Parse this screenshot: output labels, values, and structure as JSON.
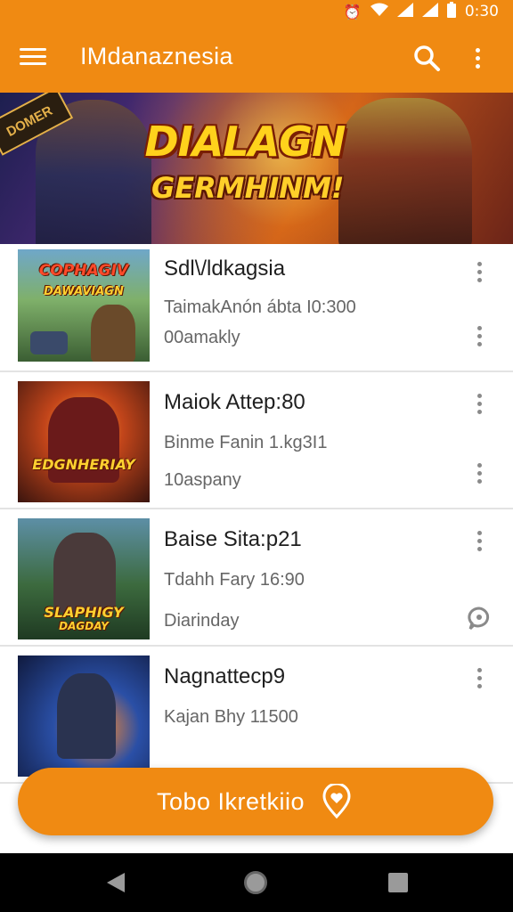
{
  "status_bar": {
    "time": "0:30",
    "icons": [
      "alarm-icon",
      "wifi-icon",
      "signal-icon",
      "signal-icon-2",
      "battery-icon"
    ]
  },
  "app_bar": {
    "title": "IMdanaznesia",
    "icons": [
      "menu-icon",
      "search-icon",
      "more-vert-icon"
    ]
  },
  "banner": {
    "title": "DIALAGN",
    "subtitle": "GERMHINM!",
    "corner_badge": "DOMER"
  },
  "items": [
    {
      "title": "Sdl\\/ldkagsia",
      "subtitle": "TaimakAnón ábta I0:300",
      "meta": "00amakly",
      "thumb_label": "COPHAGIV",
      "thumb_label_2": "DAWAVIAGN"
    },
    {
      "title": "Maiok Attep:80",
      "subtitle": "Binme Fanin 1.kg3I1",
      "meta": "10aspany",
      "thumb_label": "EDGNHERIAY",
      "thumb_label_2": ""
    },
    {
      "title": "Baise Sita:p21",
      "subtitle": "Tdahh Fary 16:90",
      "meta": "Diarinday",
      "thumb_label": "SLAPHIGY",
      "thumb_label_2": "DAGDAY"
    },
    {
      "title": "Nagnattecp9",
      "subtitle": "Kajan Bhy 11500",
      "meta": "",
      "thumb_label": "",
      "thumb_label_2": ""
    }
  ],
  "fab": {
    "label": "Tobo Ikretkiio",
    "icon": "location-heart-icon"
  },
  "nav_bar": {
    "icons": [
      "back-icon",
      "home-icon",
      "recents-icon"
    ]
  },
  "colors": {
    "accent": "#f08a12",
    "title_text": "#1f1f1f",
    "secondary_text": "#666666",
    "divider": "#e3e3e3"
  }
}
